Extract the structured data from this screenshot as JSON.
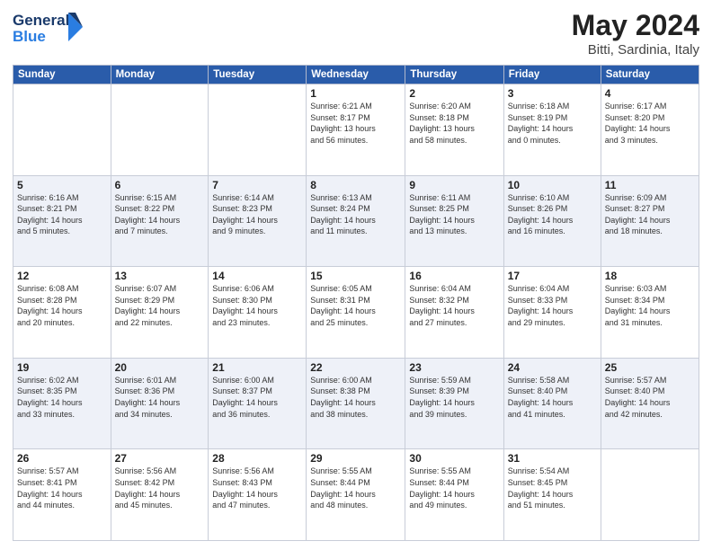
{
  "header": {
    "logo_line1": "General",
    "logo_line2": "Blue",
    "month": "May 2024",
    "location": "Bitti, Sardinia, Italy"
  },
  "days_of_week": [
    "Sunday",
    "Monday",
    "Tuesday",
    "Wednesday",
    "Thursday",
    "Friday",
    "Saturday"
  ],
  "weeks": [
    [
      {
        "day": "",
        "info": ""
      },
      {
        "day": "",
        "info": ""
      },
      {
        "day": "",
        "info": ""
      },
      {
        "day": "1",
        "info": "Sunrise: 6:21 AM\nSunset: 8:17 PM\nDaylight: 13 hours\nand 56 minutes."
      },
      {
        "day": "2",
        "info": "Sunrise: 6:20 AM\nSunset: 8:18 PM\nDaylight: 13 hours\nand 58 minutes."
      },
      {
        "day": "3",
        "info": "Sunrise: 6:18 AM\nSunset: 8:19 PM\nDaylight: 14 hours\nand 0 minutes."
      },
      {
        "day": "4",
        "info": "Sunrise: 6:17 AM\nSunset: 8:20 PM\nDaylight: 14 hours\nand 3 minutes."
      }
    ],
    [
      {
        "day": "5",
        "info": "Sunrise: 6:16 AM\nSunset: 8:21 PM\nDaylight: 14 hours\nand 5 minutes."
      },
      {
        "day": "6",
        "info": "Sunrise: 6:15 AM\nSunset: 8:22 PM\nDaylight: 14 hours\nand 7 minutes."
      },
      {
        "day": "7",
        "info": "Sunrise: 6:14 AM\nSunset: 8:23 PM\nDaylight: 14 hours\nand 9 minutes."
      },
      {
        "day": "8",
        "info": "Sunrise: 6:13 AM\nSunset: 8:24 PM\nDaylight: 14 hours\nand 11 minutes."
      },
      {
        "day": "9",
        "info": "Sunrise: 6:11 AM\nSunset: 8:25 PM\nDaylight: 14 hours\nand 13 minutes."
      },
      {
        "day": "10",
        "info": "Sunrise: 6:10 AM\nSunset: 8:26 PM\nDaylight: 14 hours\nand 16 minutes."
      },
      {
        "day": "11",
        "info": "Sunrise: 6:09 AM\nSunset: 8:27 PM\nDaylight: 14 hours\nand 18 minutes."
      }
    ],
    [
      {
        "day": "12",
        "info": "Sunrise: 6:08 AM\nSunset: 8:28 PM\nDaylight: 14 hours\nand 20 minutes."
      },
      {
        "day": "13",
        "info": "Sunrise: 6:07 AM\nSunset: 8:29 PM\nDaylight: 14 hours\nand 22 minutes."
      },
      {
        "day": "14",
        "info": "Sunrise: 6:06 AM\nSunset: 8:30 PM\nDaylight: 14 hours\nand 23 minutes."
      },
      {
        "day": "15",
        "info": "Sunrise: 6:05 AM\nSunset: 8:31 PM\nDaylight: 14 hours\nand 25 minutes."
      },
      {
        "day": "16",
        "info": "Sunrise: 6:04 AM\nSunset: 8:32 PM\nDaylight: 14 hours\nand 27 minutes."
      },
      {
        "day": "17",
        "info": "Sunrise: 6:04 AM\nSunset: 8:33 PM\nDaylight: 14 hours\nand 29 minutes."
      },
      {
        "day": "18",
        "info": "Sunrise: 6:03 AM\nSunset: 8:34 PM\nDaylight: 14 hours\nand 31 minutes."
      }
    ],
    [
      {
        "day": "19",
        "info": "Sunrise: 6:02 AM\nSunset: 8:35 PM\nDaylight: 14 hours\nand 33 minutes."
      },
      {
        "day": "20",
        "info": "Sunrise: 6:01 AM\nSunset: 8:36 PM\nDaylight: 14 hours\nand 34 minutes."
      },
      {
        "day": "21",
        "info": "Sunrise: 6:00 AM\nSunset: 8:37 PM\nDaylight: 14 hours\nand 36 minutes."
      },
      {
        "day": "22",
        "info": "Sunrise: 6:00 AM\nSunset: 8:38 PM\nDaylight: 14 hours\nand 38 minutes."
      },
      {
        "day": "23",
        "info": "Sunrise: 5:59 AM\nSunset: 8:39 PM\nDaylight: 14 hours\nand 39 minutes."
      },
      {
        "day": "24",
        "info": "Sunrise: 5:58 AM\nSunset: 8:40 PM\nDaylight: 14 hours\nand 41 minutes."
      },
      {
        "day": "25",
        "info": "Sunrise: 5:57 AM\nSunset: 8:40 PM\nDaylight: 14 hours\nand 42 minutes."
      }
    ],
    [
      {
        "day": "26",
        "info": "Sunrise: 5:57 AM\nSunset: 8:41 PM\nDaylight: 14 hours\nand 44 minutes."
      },
      {
        "day": "27",
        "info": "Sunrise: 5:56 AM\nSunset: 8:42 PM\nDaylight: 14 hours\nand 45 minutes."
      },
      {
        "day": "28",
        "info": "Sunrise: 5:56 AM\nSunset: 8:43 PM\nDaylight: 14 hours\nand 47 minutes."
      },
      {
        "day": "29",
        "info": "Sunrise: 5:55 AM\nSunset: 8:44 PM\nDaylight: 14 hours\nand 48 minutes."
      },
      {
        "day": "30",
        "info": "Sunrise: 5:55 AM\nSunset: 8:44 PM\nDaylight: 14 hours\nand 49 minutes."
      },
      {
        "day": "31",
        "info": "Sunrise: 5:54 AM\nSunset: 8:45 PM\nDaylight: 14 hours\nand 51 minutes."
      },
      {
        "day": "",
        "info": ""
      }
    ]
  ]
}
